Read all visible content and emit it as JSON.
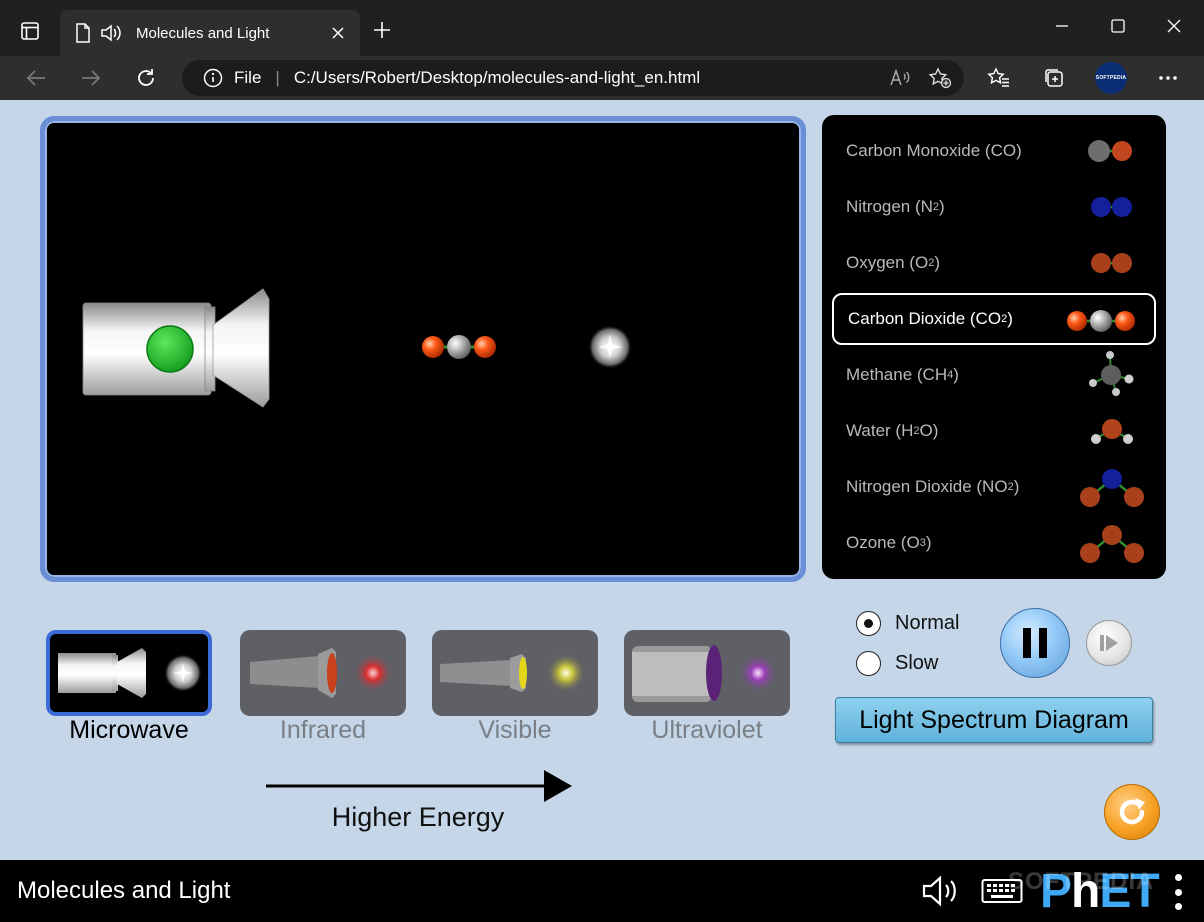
{
  "browser": {
    "tab_title": "Molecules and Light",
    "address_scheme": "File",
    "address_url": "C:/Users/Robert/Desktop/molecules-and-light_en.html",
    "profile_label": "SOFTPEDIA"
  },
  "molecules": [
    {
      "name": "Carbon Monoxide (CO)",
      "base": "Carbon Monoxide (CO)",
      "sub": "",
      "tail": "",
      "selected": false
    },
    {
      "name": "Nitrogen (N2)",
      "base": "Nitrogen (N",
      "sub": "2",
      "tail": ")",
      "selected": false
    },
    {
      "name": "Oxygen (O2)",
      "base": "Oxygen (O",
      "sub": "2",
      "tail": ")",
      "selected": false
    },
    {
      "name": "Carbon Dioxide (CO2)",
      "base": "Carbon Dioxide (CO",
      "sub": "2",
      "tail": ")",
      "selected": true
    },
    {
      "name": "Methane (CH4)",
      "base": "Methane (CH",
      "sub": "4",
      "tail": ")",
      "selected": false
    },
    {
      "name": "Water (H2O)",
      "base": "Water (H",
      "sub": "2",
      "tail": "O)",
      "selected": false
    },
    {
      "name": "Nitrogen Dioxide (NO2)",
      "base": "Nitrogen Dioxide (NO",
      "sub": "2",
      "tail": ")",
      "selected": false
    },
    {
      "name": "Ozone (O3)",
      "base": "Ozone (O",
      "sub": "3",
      "tail": ")",
      "selected": false
    }
  ],
  "light_sources": [
    {
      "label": "Microwave",
      "selected": true,
      "color": "#ffffff"
    },
    {
      "label": "Infrared",
      "selected": false,
      "color": "#e23b3b"
    },
    {
      "label": "Visible",
      "selected": false,
      "color": "#e8e23c"
    },
    {
      "label": "Ultraviolet",
      "selected": false,
      "color": "#b04fd6"
    }
  ],
  "energy_label": "Higher Energy",
  "speed": {
    "normal_label": "Normal",
    "slow_label": "Slow",
    "selected": "Normal"
  },
  "spectrum_button_label": "Light Spectrum Diagram",
  "sim_title": "Molecules and Light",
  "phet_logo": {
    "p": "P",
    "h": "h",
    "et": "ET"
  },
  "watermark": "SOFTPEDIA",
  "colors": {
    "sim_background": "#c5d6e9",
    "carbon": "#9a9a9a",
    "oxygen": "#ff4a12",
    "nitrogen": "#1c2ad8",
    "emitter_indicator": "#22c02a",
    "play_area_border": "#6a8fd7"
  }
}
